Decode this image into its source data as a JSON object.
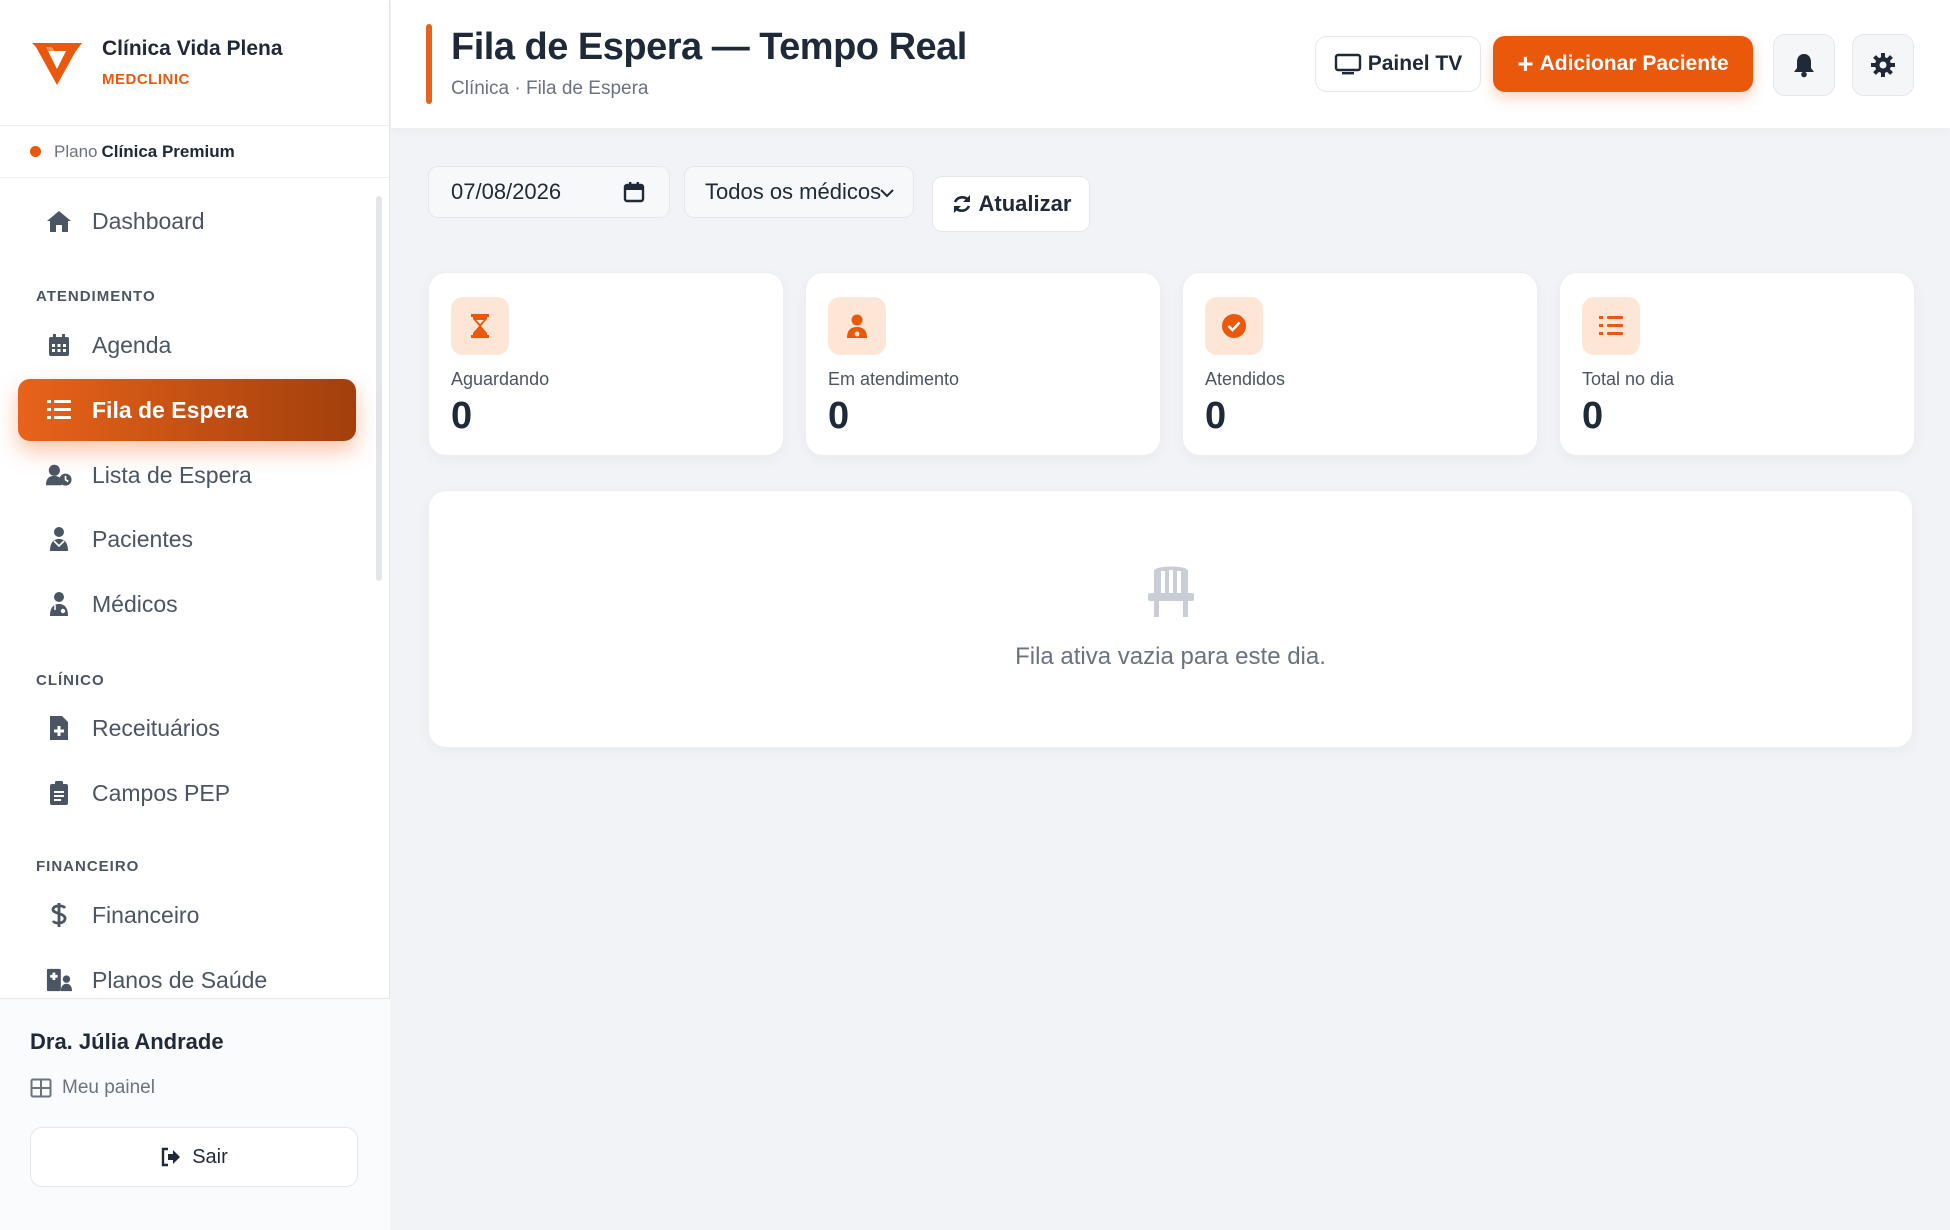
{
  "brand": {
    "name": "Clínica Vida Plena",
    "sub": "MEDCLINIC"
  },
  "plan": {
    "label": "Plano",
    "name": "Clínica Premium"
  },
  "sidebar": {
    "items": [
      {
        "label": "Dashboard",
        "icon": "home-icon"
      },
      {
        "label": "Agenda",
        "icon": "calendar-icon"
      },
      {
        "label": "Fila de Espera",
        "icon": "list-ordered-icon"
      },
      {
        "label": "Lista de Espera",
        "icon": "user-clock-icon"
      },
      {
        "label": "Pacientes",
        "icon": "patient-icon"
      },
      {
        "label": "Médicos",
        "icon": "doctor-icon"
      },
      {
        "label": "Receituários",
        "icon": "file-medical-icon"
      },
      {
        "label": "Campos PEP",
        "icon": "clipboard-icon"
      },
      {
        "label": "Financeiro",
        "icon": "dollar-icon"
      },
      {
        "label": "Planos de Saúde",
        "icon": "hospital-user-icon"
      }
    ],
    "sections": {
      "atendimento": "ATENDIMENTO",
      "clinico": "CLÍNICO",
      "financeiro": "FINANCEIRO"
    },
    "active": "Fila de Espera"
  },
  "user": {
    "name": "Dra. Júlia Andrade",
    "panel_label": "Meu painel",
    "logout_label": "Sair"
  },
  "header": {
    "title": "Fila de Espera — Tempo Real",
    "breadcrumb": "Clínica · Fila de Espera",
    "tv_label": "Painel TV",
    "add_label": "Adicionar Paciente",
    "add_symbol": "+"
  },
  "filters": {
    "date": "07/08/2026",
    "doctor": "Todos os médicos",
    "refresh_label": "Atualizar"
  },
  "stats": [
    {
      "label": "Aguardando",
      "value": "0",
      "icon": "hourglass-icon"
    },
    {
      "label": "Em atendimento",
      "value": "0",
      "icon": "user-doctor-icon"
    },
    {
      "label": "Atendidos",
      "value": "0",
      "icon": "check-circle-icon"
    },
    {
      "label": "Total no dia",
      "value": "0",
      "icon": "list-ol-icon"
    }
  ],
  "empty": {
    "message": "Fila ativa vazia para este dia.",
    "icon": "chair-icon"
  },
  "colors": {
    "accent": "#ea580c",
    "accent_dark": "#a23f0c",
    "stat_icon_bg": "#fde6d6"
  }
}
